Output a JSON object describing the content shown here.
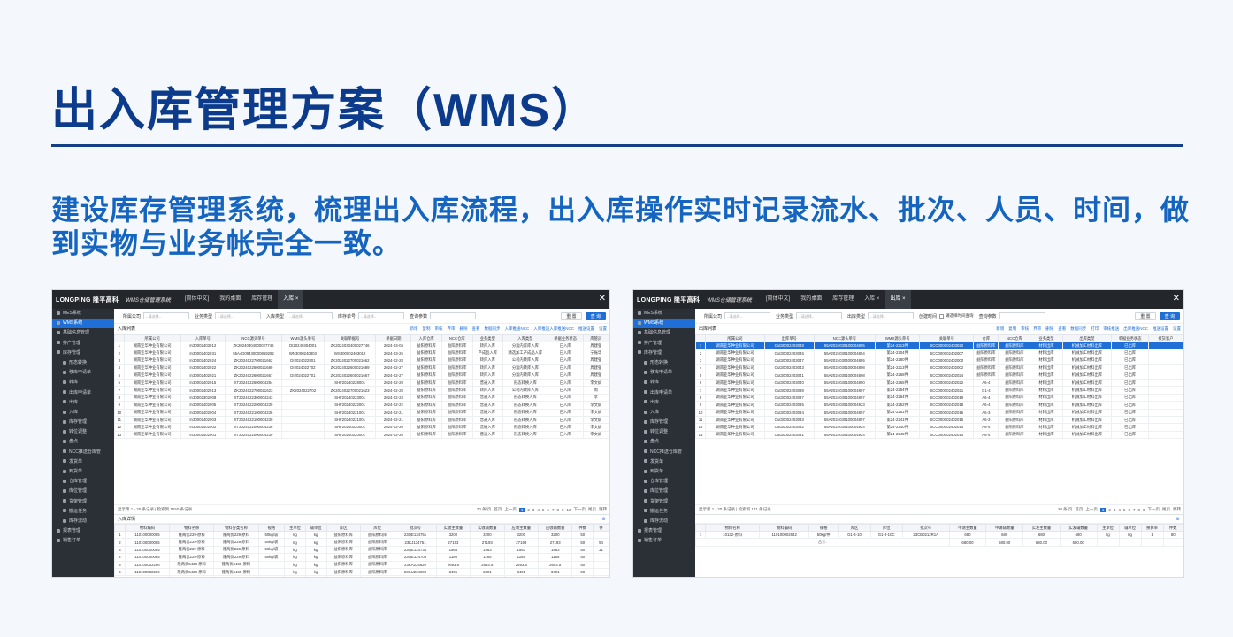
{
  "slide": {
    "title": "出入库管理方案（WMS）",
    "subtitle": "建设库存管理系统，梳理出入库流程，出入库操作实时记录流水、批次、人员、时间，做到实物与业务帐完全一致。"
  },
  "common": {
    "logo": "LONGPING 隆平高科",
    "system": "WMS仓储管理系统",
    "lang": "[简体中文]",
    "desk": "我的桌面",
    "stock_menu": "库存管理",
    "sidebar": [
      "MES系统",
      "WMS系统",
      "基础信息管理",
      "排产管理",
      "库存管理",
      "形态转换",
      "移库申请单",
      "转库",
      "出库申请单",
      "出库",
      "入库",
      "库存管理",
      "转位调整",
      "盘点",
      "NCC推送仓库管",
      "发货单",
      "到货单",
      "仓库管理",
      "库位管理",
      "货架管理",
      "搬运任务",
      "库存流动",
      "报表管理",
      "销售订单"
    ]
  },
  "shotA": {
    "tabs": [
      "入库"
    ],
    "filters": [
      "所属公司",
      "业务类型",
      "入库类型",
      "库存单号",
      "查询参数"
    ],
    "placeholder": "--请选择--",
    "reset": "重 置",
    "query": "查 询",
    "list_title": "入库列表",
    "actions": [
      "新增",
      "复制",
      "审核",
      "弃审",
      "删除",
      "查看",
      "数据同步",
      "入库推送NCC",
      "入库推送入库推送NCC",
      "推送设置",
      "设置"
    ],
    "columns": [
      "",
      "所属公司",
      "入库单号",
      "NCC源头单号",
      "WMS源头单号",
      "关联单据号",
      "单据日期",
      "入库仓库",
      "NCC仓库",
      "业务类型",
      "入库类型",
      "单据业务状态",
      "库管员"
    ],
    "rows": [
      [
        "1",
        "湖南亚华种业有限公司",
        "In30002403012",
        "ZK20240304000027746",
        "DI20240304001",
        "ZK2024030400027746",
        "2024-03-04",
        "益阳原料库",
        "益阳原料库",
        "转库入库",
        "分运内库库入库",
        "已入库",
        "周建强"
      ],
      [
        "2",
        "湖南亚华种业有限公司",
        "In30002402031",
        "55A4D09430000859292",
        "WN3000240803",
        "WS300002403012",
        "2024-03-25",
        "益阳原料库",
        "益阳原料库",
        "产成品入库",
        "精选加工产成品入库",
        "已入库",
        "宁振华"
      ],
      [
        "3",
        "湖南亚华种业有限公司",
        "In30002402024",
        "ZK2024022700021662",
        "DI2024022801",
        "ZK2024022700021662",
        "2024-02-28",
        "益阳原料库",
        "益阳原料库",
        "转库入库",
        "公司内转库入库",
        "已入库",
        "周建强"
      ],
      [
        "4",
        "湖南亚华种业有限公司",
        "In30002402022",
        "ZK2024022600021689",
        "DI2024022702",
        "ZK2024022600021689",
        "2024-02-27",
        "益阳原料库",
        "益阳原料库",
        "转库入库",
        "分运内转库入库",
        "已入库",
        "周建强"
      ],
      [
        "5",
        "湖南亚华种业有限公司",
        "In30002402021",
        "ZK2024022600021667",
        "DI2024022701",
        "ZK2024022600021667",
        "2024-02-27",
        "益阳原料库",
        "益阳原料库",
        "转库入库",
        "分运内转库入库",
        "已入库",
        "周建强"
      ],
      [
        "6",
        "湖南亚华种业有限公司",
        "In30002402015",
        "XT2024022600004284",
        "",
        "SHF20240228001",
        "2024-02-28",
        "益阳原料库",
        "益阳原料库",
        "普通入库",
        "形态转换入库",
        "已入库",
        "李文斌"
      ],
      [
        "7",
        "湖南亚华种业有限公司",
        "In30002402013",
        "ZK2024022700021623",
        "ZK2024022702",
        "ZK2024022700021623",
        "2024-02-28",
        "益阳原料库",
        "益阳原料库",
        "转库入库",
        "公司内转库入库",
        "已入库",
        "周"
      ],
      [
        "8",
        "湖南亚华种业有限公司",
        "In30002302008",
        "XT2024022300004243",
        "",
        "SHF20240223001",
        "2024-02-23",
        "益阳原料库",
        "益阳原料库",
        "普通入库",
        "形态转换入库",
        "已入库",
        "李"
      ],
      [
        "9",
        "湖南亚华种业有限公司",
        "In30002402005",
        "XT2024022200004239",
        "",
        "SHF20240222001",
        "2024-02-22",
        "益阳原料库",
        "益阳原料库",
        "普通入库",
        "形态转换入库",
        "已入库",
        "李文斌"
      ],
      [
        "10",
        "湖南亚华种业有限公司",
        "In30002402004",
        "XT2024022100004236",
        "",
        "SHF20240221001",
        "2024-02-21",
        "益阳原料库",
        "益阳原料库",
        "普通入库",
        "形态转换入库",
        "已入库",
        "李文斌"
      ],
      [
        "11",
        "湖南亚华种业有限公司",
        "In30002402003",
        "XT2024022100004230",
        "",
        "SHF20240221001",
        "2024-02-21",
        "益阳原料库",
        "益阳原料库",
        "普通入库",
        "形态转换入库",
        "已入库",
        "李文斌"
      ],
      [
        "12",
        "湖南亚华种业有限公司",
        "In30002402002",
        "XT2024022000004236",
        "",
        "SHF20240220001",
        "2024-02-20",
        "益阳原料库",
        "益阳原料库",
        "普通入库",
        "形态转换入库",
        "已入库",
        "李文斌"
      ],
      [
        "13",
        "湖南亚华种业有限公司",
        "In30002402001",
        "XT2024022000004239",
        "",
        "SHF20240220001",
        "2024-02-20",
        "益阳原料库",
        "益阳原料库",
        "普通入库",
        "形态转换入库",
        "已入库",
        "李文斌"
      ]
    ],
    "pager_info": "显示第 1 - 20 条记录 | 检索到 1550 条记录",
    "page_size": "20 条/页",
    "pages": [
      "首页",
      "上一页",
      "1",
      "2",
      "3",
      "4",
      "5",
      "6",
      "7",
      "8",
      "9",
      "10",
      "下一页",
      "尾页"
    ],
    "goto": "跳转",
    "detail_tab": "入库详情",
    "detail_columns": [
      "",
      "物料编码",
      "物料名称",
      "物料分类名称",
      "规格",
      "主单位",
      "辅单位",
      "库区",
      "库位",
      "批次号",
      "实收主数量",
      "实收辅数量",
      "应收主数量",
      "应收辅数量",
      "件数",
      "件"
    ],
    "detail_rows": [
      [
        "1",
        "110100000085",
        "隆两优229-原料",
        "隆两优229-原料",
        "50kg/袋",
        "kg",
        "kg",
        "益阳原料库",
        "益阳原料库",
        "23QE134751",
        "3200",
        "3200",
        "3200",
        "3200",
        "50",
        ""
      ],
      [
        "2",
        "110100000085",
        "隆两优229-原料",
        "隆两优229-原料",
        "50kg/袋",
        "kg",
        "kg",
        "益阳原料库",
        "益阳原料库",
        "23KJ134751",
        "27193",
        "27193",
        "27193",
        "27193",
        "50",
        "54"
      ],
      [
        "3",
        "110100000085",
        "隆两优229-原料",
        "隆两优229-原料",
        "50kg/袋",
        "kg",
        "kg",
        "益阳原料库",
        "益阳原料库",
        "23QE124734",
        "1563",
        "1563",
        "1563",
        "1563",
        "50",
        "31"
      ],
      [
        "4",
        "110100000085",
        "隆两优229-原料",
        "隆两优229-原料",
        "50kg/袋",
        "kg",
        "kg",
        "益阳原料库",
        "益阳原料库",
        "23QE124708",
        "1185",
        "1185",
        "1185",
        "1185",
        "50",
        ""
      ],
      [
        "5",
        "110100002286",
        "隆两优5438-原料",
        "隆两优5438-原料",
        "",
        "kg",
        "kg",
        "益阳原料库",
        "益阳原料库",
        "23KA234620",
        "2693.5",
        "2693.5",
        "2693.5",
        "2693.5",
        "50",
        ""
      ],
      [
        "6",
        "110100002286",
        "隆两优5438-原料",
        "隆两优5438-原料",
        "",
        "kg",
        "kg",
        "益阳原料库",
        "益阳原料库",
        "23KU234603",
        "3491",
        "3491",
        "3491",
        "3491",
        "50",
        ""
      ],
      [
        "7",
        "110100002286",
        "隆两优5438-原料",
        "隆两优5438-原料",
        "",
        "kg",
        "kg",
        "益阳原料库",
        "益阳原料库",
        "23PF234601",
        "26355",
        "26355",
        "26355",
        "26355",
        "50",
        "52"
      ]
    ],
    "detail_total_label": "合计:",
    "detail_totals": [
      "74353.50",
      "74353.50",
      "74353.50",
      "74353.50"
    ]
  },
  "shotB": {
    "tabs": [
      "入库",
      "出库"
    ],
    "filters": [
      "所属公司",
      "业务类型",
      "出库类型",
      "创建时间",
      "查询参数"
    ],
    "placeholder": "--请选择--",
    "checkbox_label": "请选择时间查询",
    "reset": "重 置",
    "query": "查 询",
    "list_title": "出库列表",
    "actions": [
      "新增",
      "复制",
      "审核",
      "弃审",
      "删除",
      "查看",
      "数据同步",
      "打印",
      "审核推送",
      "出库推送NCC",
      "推送设置",
      "设置"
    ],
    "columns": [
      "",
      "所属公司",
      "出库单号",
      "NCC源头单号",
      "WMS源头单号",
      "关联单号",
      "仓库",
      "NCC仓库",
      "业务类型",
      "出库类型",
      "单据业务状态",
      "接货客户"
    ],
    "rows": [
      [
        "1",
        "湖南亚华种业有限公司",
        "Out30002403048",
        "55A2024030100004895",
        "第24-2213件",
        "SCC000002403020",
        "益阳原料库",
        "益阳原料库",
        "材料出库",
        "机械加工材料出库",
        "已出库",
        ""
      ],
      [
        "2",
        "湖南亚华种业有限公司",
        "Out30002403046",
        "55A2024030100004854",
        "第24-2204件",
        "SCC000002402007",
        "益阳原料库",
        "益阳原料库",
        "材料出库",
        "机械加工材料出库",
        "已出库",
        ""
      ],
      [
        "3",
        "湖南亚华种业有限公司",
        "Out30002403047",
        "55A2024030400004895",
        "第24-2280件",
        "SCC000002402000",
        "益阳原料库",
        "益阳原料库",
        "材料出库",
        "机械加工材料出库",
        "已出库",
        ""
      ],
      [
        "4",
        "湖南亚华种业有限公司",
        "Out30002403043",
        "55A2024030100004898",
        "第24-2213件",
        "SCC000002402002",
        "益阳原料库",
        "益阳原料库",
        "材料出库",
        "机械加工材料出库",
        "已出库",
        ""
      ],
      [
        "5",
        "湖南亚华种业有限公司",
        "Out30002403041",
        "55A2024030100004898",
        "第24-2268件",
        "SCC000002402024",
        "益阳原料库",
        "益阳原料库",
        "材料出库",
        "机械加工材料出库",
        "已出库",
        ""
      ],
      [
        "6",
        "湖南亚华种业有限公司",
        "Out30002403040",
        "55A2024030100004890",
        "第24-2265件",
        "SCC000002402022",
        "A6-4",
        "益阳原料库",
        "材料出库",
        "机械加工材料出库",
        "已出库",
        ""
      ],
      [
        "7",
        "湖南亚华种业有限公司",
        "Out30002403038",
        "55A2024030100004897",
        "第24-2254件",
        "SCC000002402021",
        "G1-4",
        "益阳原料库",
        "材料出库",
        "机械加工材料出库",
        "已出库",
        ""
      ],
      [
        "8",
        "湖南亚华种业有限公司",
        "Out30002403037",
        "55A2024030100004897",
        "第24-2264件",
        "SCC000002402019",
        "A6-4",
        "益阳原料库",
        "材料出库",
        "机械加工材料出库",
        "已出库",
        ""
      ],
      [
        "9",
        "湖南亚华种业有限公司",
        "Out30002403035",
        "55A2024030100004923",
        "第24-2252件",
        "SCC000002402018",
        "A6-4",
        "益阳原料库",
        "材料出库",
        "机械加工材料出库",
        "已出库",
        ""
      ],
      [
        "10",
        "湖南亚华种业有限公司",
        "Out30002403034",
        "55A2024030100004897",
        "第24-2251件",
        "SCC000002402016",
        "A6-3",
        "益阳原料库",
        "材料出库",
        "机械加工材料出库",
        "已出库",
        ""
      ],
      [
        "11",
        "湖南亚华种业有限公司",
        "Out30002403033",
        "55A2024030100004897",
        "第24-2241件",
        "SCC000002402015",
        "A6-3",
        "益阳原料库",
        "材料出库",
        "机械加工材料出库",
        "已出库",
        ""
      ],
      [
        "12",
        "湖南亚华种业有限公司",
        "Out30002403032",
        "55A2024030100004924",
        "第24-2240件",
        "SCC000002402014",
        "A6-4",
        "益阳原料库",
        "材料出库",
        "机械加工材料出库",
        "已出库",
        ""
      ],
      [
        "13",
        "湖南亚华种业有限公司",
        "Out30002403031",
        "55A2024030100004924",
        "第24-2245件",
        "SCC000002402014",
        "A6-4",
        "益阳原料库",
        "材料出库",
        "机械加工材料出库",
        "已出库",
        ""
      ]
    ],
    "pager_info": "显示第 1 - 20 条记录 | 检索到 171 条记录",
    "page_size": "20 条/页",
    "pages": [
      "首页",
      "上一页",
      "1",
      "2",
      "3",
      "4",
      "5",
      "6",
      "7",
      "8",
      "9",
      "下一页",
      "尾页"
    ],
    "goto": "跳转",
    "detail_columns": [
      "",
      "物料名称",
      "物料编码",
      "规格",
      "库区",
      "库位",
      "批次号",
      "申请主数量",
      "申请辅数量",
      "实发主数量",
      "实发辅数量",
      "主单位",
      "辅单位",
      "换算率",
      "件数"
    ],
    "detail_rows": [
      [
        "1",
        "10132-原料",
        "110100002642",
        "50kg/件",
        "G1-4-10",
        "G1-4-10C",
        "23CB0212R1A",
        "680",
        "680",
        "680",
        "680",
        "kg",
        "kg",
        "1",
        "80"
      ]
    ],
    "detail_total_label": "合计:",
    "detail_totals": [
      "680.00",
      "680.00",
      "680.00",
      "680.00"
    ]
  }
}
